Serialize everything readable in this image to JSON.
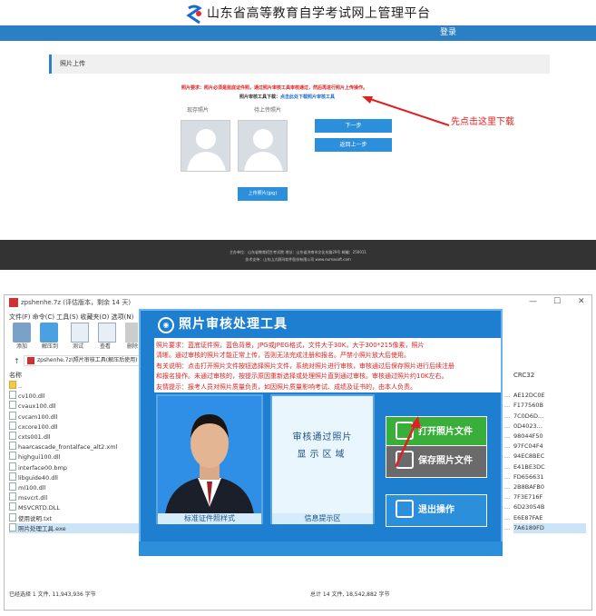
{
  "site": {
    "title": "山东省高等教育自学考试网上管理平台",
    "login": "登录",
    "panel_title": "照片上传",
    "photo_requirement": "照片要求：照片必须是蓝底证件照，通过照片审核工具审核通过，然后再进行照片上传操作。",
    "download_prefix": "照片审核工具下载：",
    "download_link": "点击此处下载照片审核工具",
    "label_existing": "现存照片",
    "label_pending": "待上传照片",
    "next_button": "下一步",
    "back_button": "返回上一步",
    "upload_button": "上传照片(jpg)",
    "callout": "先点击这里下载",
    "footer_line1": "主办单位：山东省教育招生考试院   地址：山东省济南市文化东路29号   邮编：250011",
    "footer_line2": "技术支持：山东山大鸥玛软件股份有限公司  www.eumasoft.com"
  },
  "window": {
    "title": "zpshenhe.7z (评估版本，剩余 14 天)",
    "menu": "文件(F)  命令(C)  工具(S)  收藏夹(O)  选项(N)",
    "toolbar": [
      "添加",
      "解压到",
      "测试",
      "查看",
      "删除"
    ],
    "address": "zpshenhe.7z\\照片审核工具(解压后使用)",
    "col_name": "名称",
    "col_crc": "CRC32",
    "files": [
      {
        "name": "..",
        "crc": ""
      },
      {
        "name": "cv100.dll",
        "crc": "AE12DC0E"
      },
      {
        "name": "cvaux100.dll",
        "crc": "F177560B"
      },
      {
        "name": "cvcam100.dll",
        "crc": "7C0D6D..."
      },
      {
        "name": "cxcore100.dll",
        "crc": "0D4023..."
      },
      {
        "name": "cxts001.dll",
        "crc": "98044F50"
      },
      {
        "name": "haarcascade_frontalface_alt2.xml",
        "crc": "97FC04F4"
      },
      {
        "name": "highgui100.dll",
        "crc": "94EC8BEC"
      },
      {
        "name": "interface00.bmp",
        "crc": "E41BE3DC"
      },
      {
        "name": "libguide40.dll",
        "crc": "FD656631"
      },
      {
        "name": "ml100.dll",
        "crc": "2B8BAFB0"
      },
      {
        "name": "msvcrt.dll",
        "crc": "7F3E716F"
      },
      {
        "name": "MSVCRTD.DLL",
        "crc": "6D23054B"
      },
      {
        "name": "使用说明.txt",
        "crc": "E6E87FAE"
      },
      {
        "name": "照片处理工具.exe",
        "crc": "7A6189FD"
      }
    ],
    "status_left": "已经选择 1 文件, 11,943,936 字节",
    "status_mid": "总计 14 文件, 18,542,882 字节"
  },
  "tool": {
    "title": "照片审核处理工具",
    "line1": "照片要求：蓝底证件照，蓝色背景，JPG或JPEG格式，文件大于30K，大于300*215像素，照片",
    "line2": "清晰。通过审核的照片才能正常上传，否则无法完成注册和报名。严禁小照片放大后使用。",
    "line3": "有关说明：点击打开照片文件按钮选择照片文件，系统对照片进行审核，审核通过后保存照片进行后续注册",
    "line4": "和报名操作。未通过审核的，按提示原因重新选择或处理照片直到通过审核。审核通过照片约10K左右。",
    "line5": "友情提示：报考人员对照片质量负责，如因照片质量影响考试、成绩及证书的，由本人负责。",
    "caption_photo": "标准证件照样式",
    "caption_info": "信息提示区",
    "info_1": "审核通过照片",
    "info_2": "显示区域",
    "open_button": "打开照片文件",
    "save_button": "保存照片文件",
    "exit_button": "退出操作"
  }
}
